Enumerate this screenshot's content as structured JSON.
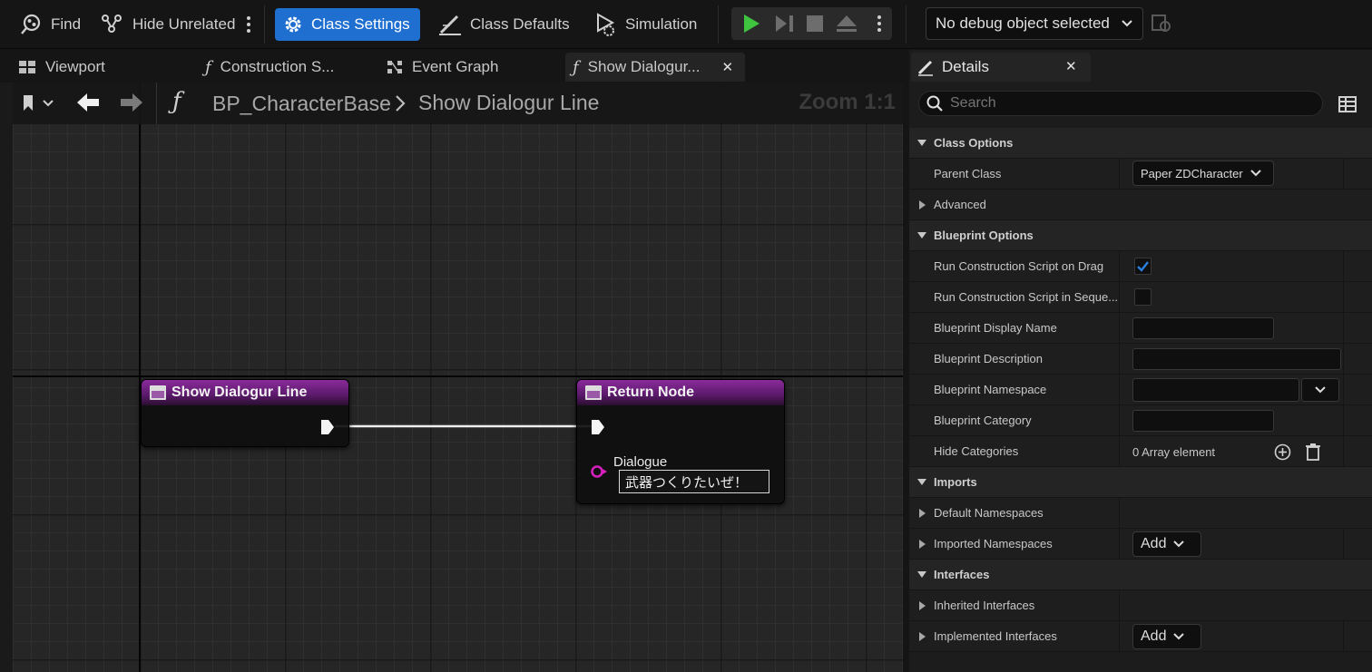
{
  "toolbar": {
    "find_label": "Find",
    "hide_unrelated_label": "Hide Unrelated",
    "class_settings_label": "Class Settings",
    "class_defaults_label": "Class Defaults",
    "simulation_label": "Simulation",
    "debug_select_value": "No debug object selected",
    "accent_color": "#1f6fd1",
    "play_color": "#3fc43f"
  },
  "tabs": [
    {
      "label": "Viewport",
      "icon": "viewport-icon"
    },
    {
      "label": "Construction S...",
      "icon": "function-icon"
    },
    {
      "label": "Event Graph",
      "icon": "graph-icon"
    },
    {
      "label": "Show Dialogur...",
      "icon": "function-icon",
      "active": true
    }
  ],
  "graph": {
    "breadcrumb_root": "BP_CharacterBase",
    "breadcrumb_current": "Show Dialogur Line",
    "zoom_label": "Zoom 1:1",
    "nodes": {
      "entry": {
        "title": "Show Dialogur Line"
      },
      "return": {
        "title": "Return Node",
        "pin_label": "Dialogue",
        "pin_value": "武器つくりたいぜ！",
        "pin_color": "#d71fbd"
      }
    },
    "node_header_color": "#8a2a9a"
  },
  "details": {
    "tab_label": "Details",
    "search_placeholder": "Search",
    "rows": [
      {
        "type": "cat",
        "label": "Class Options"
      },
      {
        "type": "prop",
        "label": "Parent Class",
        "value_kind": "dropdown",
        "value": "Paper ZDCharacter"
      },
      {
        "type": "prop",
        "label": "Advanced",
        "collapsed": true
      },
      {
        "type": "cat",
        "label": "Blueprint Options"
      },
      {
        "type": "prop",
        "label": "Run Construction Script on Drag",
        "value_kind": "checkbox",
        "checked": true
      },
      {
        "type": "prop",
        "label": "Run Construction Script in Seque...",
        "value_kind": "checkbox",
        "checked": false
      },
      {
        "type": "prop",
        "label": "Blueprint Display Name",
        "value_kind": "text"
      },
      {
        "type": "prop",
        "label": "Blueprint Description",
        "value_kind": "text-wide"
      },
      {
        "type": "prop",
        "label": "Blueprint Namespace",
        "value_kind": "text-combo"
      },
      {
        "type": "prop",
        "label": "Blueprint Category",
        "value_kind": "text"
      },
      {
        "type": "prop",
        "label": "Hide Categories",
        "value_kind": "array",
        "value": "0 Array element"
      },
      {
        "type": "cat",
        "label": "Imports"
      },
      {
        "type": "prop",
        "label": "Default Namespaces",
        "collapsed": true
      },
      {
        "type": "prop",
        "label": "Imported Namespaces",
        "collapsed": true,
        "value_kind": "add",
        "value": "Add"
      },
      {
        "type": "cat",
        "label": "Interfaces"
      },
      {
        "type": "prop",
        "label": "Inherited Interfaces",
        "collapsed": true
      },
      {
        "type": "prop",
        "label": "Implemented Interfaces",
        "collapsed": true,
        "value_kind": "add",
        "value": "Add"
      }
    ]
  }
}
